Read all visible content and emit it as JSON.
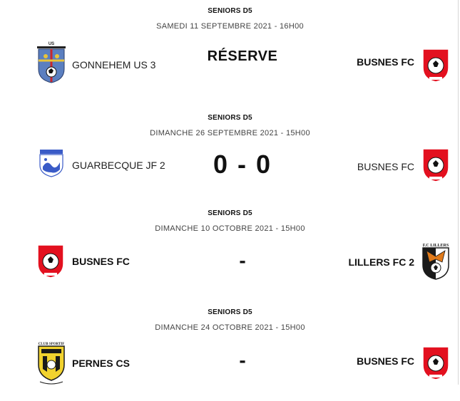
{
  "matches": [
    {
      "competition": "SENIORS D5",
      "date": "SAMEDI 11 SEPTEMBRE 2021 - 16H00",
      "home": {
        "name": "GONNEHEM US 3",
        "logo": "gonnehem-crest-icon",
        "bold": false
      },
      "away": {
        "name": "BUSNES FC",
        "logo": "busnes-crest-icon",
        "bold": true
      },
      "center": "RÉSERVE"
    },
    {
      "competition": "SENIORS D5",
      "date": "DIMANCHE 26 SEPTEMBRE 2021 - 15H00",
      "home": {
        "name": "GUARBECQUE JF 2",
        "logo": "guarbecque-crest-icon",
        "bold": false
      },
      "away": {
        "name": "BUSNES FC",
        "logo": "busnes-crest-icon",
        "bold": false
      },
      "center": "0 - 0"
    },
    {
      "competition": "SENIORS D5",
      "date": "DIMANCHE 10 OCTOBRE 2021 - 15H00",
      "home": {
        "name": "BUSNES FC",
        "logo": "busnes-crest-icon",
        "bold": true
      },
      "away": {
        "name": "LILLERS FC 2",
        "logo": "lillers-crest-icon",
        "bold": true
      },
      "center": "-"
    },
    {
      "competition": "SENIORS D5",
      "date": "DIMANCHE 24 OCTOBRE 2021 - 15H00",
      "home": {
        "name": "PERNES CS",
        "logo": "pernes-crest-icon",
        "bold": true
      },
      "away": {
        "name": "BUSNES FC",
        "logo": "busnes-crest-icon",
        "bold": true
      },
      "center": "-"
    }
  ],
  "logos": {
    "gonnehem": {
      "top_text": "US",
      "colors": {
        "blue": "#5b7fc0",
        "yellow": "#e8c43a",
        "red": "#c8262c"
      }
    },
    "busnes": {
      "colors": {
        "red": "#e3101f",
        "white": "#ffffff"
      }
    },
    "lillers": {
      "top_text": "F.C LILLERS",
      "colors": {
        "black": "#1a1a1a",
        "white": "#ffffff",
        "orange": "#e07a1a"
      }
    },
    "pernes": {
      "top_text": "CLUB SPORTIF",
      "colors": {
        "yellow": "#f1d22e",
        "black": "#1a1a1a"
      }
    },
    "guarbecque": {
      "colors": {
        "blue": "#3a5bc7",
        "white": "#ffffff"
      }
    }
  }
}
